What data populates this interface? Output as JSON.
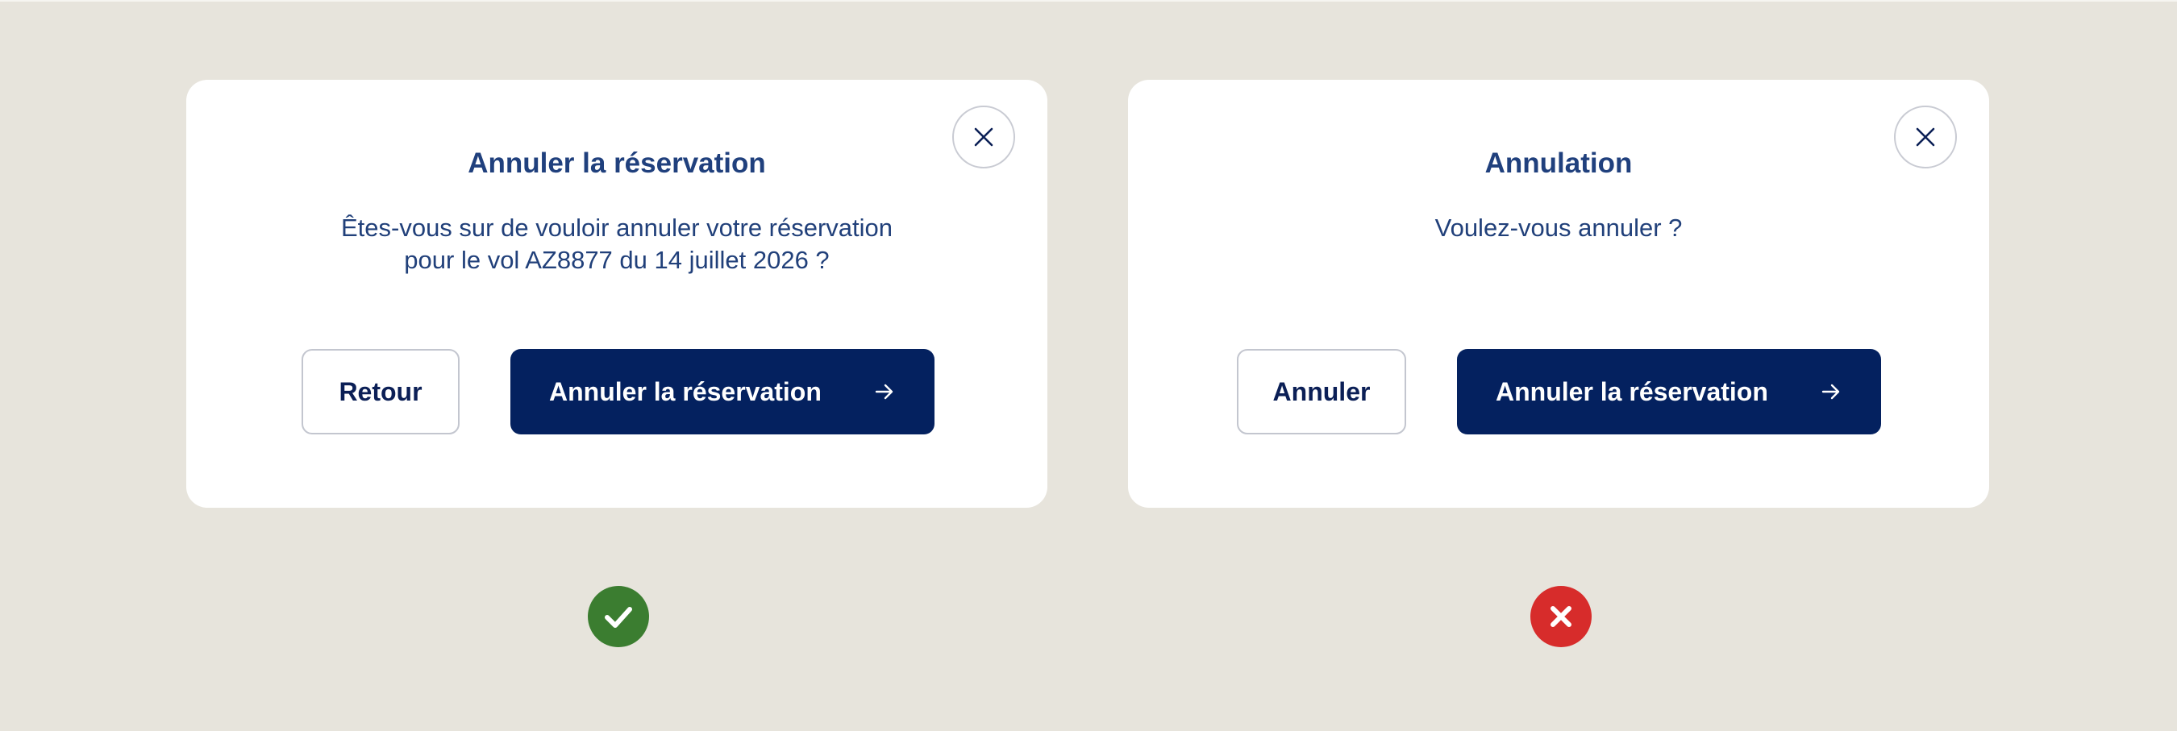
{
  "colors": {
    "background": "#e7e4dc",
    "card": "#ffffff",
    "title_text": "#20407d",
    "primary_button": "#04215f",
    "good_badge": "#3b7d30",
    "bad_badge": "#d72c2b"
  },
  "dialogs": [
    {
      "close_icon": "close-icon",
      "title": "Annuler la réservation",
      "message": "Êtes-vous sur de vouloir annuler votre réservation\npour le vol AZ8877 du 14 juillet 2026 ?",
      "secondary_label": "Retour",
      "primary_label": "Annuler la réservation",
      "primary_icon": "arrow-right-icon"
    },
    {
      "close_icon": "close-icon",
      "title": "Annulation",
      "message": "Voulez-vous annuler ?",
      "secondary_label": "Annuler",
      "primary_label": "Annuler la réservation",
      "primary_icon": "arrow-right-icon"
    }
  ],
  "verdicts": [
    {
      "icon": "check-icon",
      "status": "correct"
    },
    {
      "icon": "cross-icon",
      "status": "incorrect"
    }
  ]
}
